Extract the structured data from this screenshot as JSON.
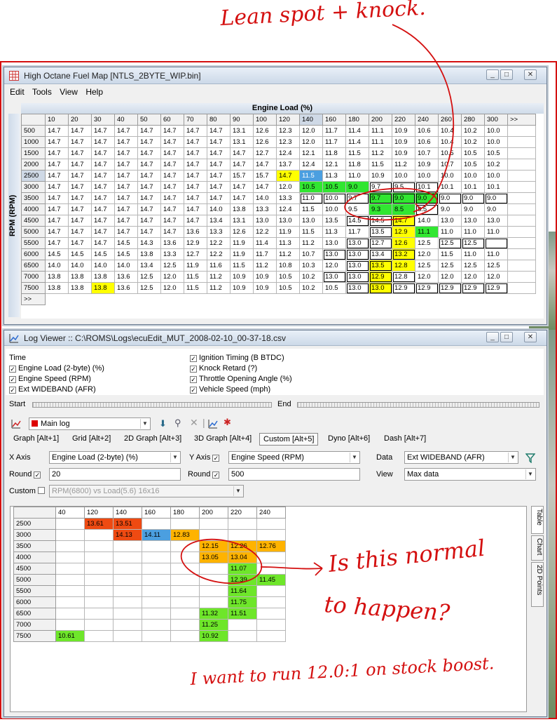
{
  "colors": {
    "cursor": "#4b9fe0",
    "yellow": "#ffff00",
    "green": "#31e631",
    "red": "#ee4a12",
    "orange": "#ffb300",
    "annotation": "#d41010"
  },
  "annotations": {
    "top": "Lean spot + knock.",
    "middle_l1": "Is this normal",
    "middle_l2": "to happen?",
    "bottom": "I want to run 12.0:1 on stock boost."
  },
  "fuel_window": {
    "title": "High Octane Fuel Map [NTLS_2BYTE_WIP.bin]",
    "menu": [
      "Edit",
      "Tools",
      "View",
      "Help"
    ],
    "x_title": "Engine Load (%)",
    "y_title": "RPM (RPM)",
    "columns": [
      "10",
      "20",
      "30",
      "40",
      "50",
      "60",
      "70",
      "80",
      "90",
      "100",
      "120",
      "140",
      "160",
      "180",
      "200",
      "220",
      "240",
      "260",
      "280",
      "300",
      ">>"
    ],
    "rows": [
      {
        "rpm": "500",
        "v": [
          "14.7",
          "14.7",
          "14.7",
          "14.7",
          "14.7",
          "14.7",
          "14.7",
          "14.7",
          "13.1",
          "12.6",
          "12.3",
          "12.0",
          "11.7",
          "11.4",
          "11.1",
          "10.9",
          "10.6",
          "10.4",
          "10.2",
          "10.0"
        ]
      },
      {
        "rpm": "1000",
        "v": [
          "14.7",
          "14.7",
          "14.7",
          "14.7",
          "14.7",
          "14.7",
          "14.7",
          "14.7",
          "13.1",
          "12.6",
          "12.3",
          "12.0",
          "11.7",
          "11.4",
          "11.1",
          "10.9",
          "10.6",
          "10.4",
          "10.2",
          "10.0"
        ]
      },
      {
        "rpm": "1500",
        "v": [
          "14.7",
          "14.7",
          "14.7",
          "14.7",
          "14.7",
          "14.7",
          "14.7",
          "14.7",
          "14.7",
          "12.7",
          "12.4",
          "12.1",
          "11.8",
          "11.5",
          "11.2",
          "10.9",
          "10.7",
          "10.5",
          "10.5",
          "10.5"
        ]
      },
      {
        "rpm": "2000",
        "v": [
          "14.7",
          "14.7",
          "14.7",
          "14.7",
          "14.7",
          "14.7",
          "14.7",
          "14.7",
          "14.7",
          "14.7",
          "13.7",
          "12.4",
          "12.1",
          "11.8",
          "11.5",
          "11.2",
          "10.9",
          "10.7",
          "10.5",
          "10.2"
        ]
      },
      {
        "rpm": "2500",
        "v": [
          "14.7",
          "14.7",
          "14.7",
          "14.7",
          "14.7",
          "14.7",
          "14.7",
          "14.7",
          "15.7",
          "15.7",
          "14.7",
          "11.5",
          "11.3",
          "11.0",
          "10.9",
          "10.0",
          "10.0",
          "10.0",
          "10.0",
          "10.0"
        ]
      },
      {
        "rpm": "3000",
        "v": [
          "14.7",
          "14.7",
          "14.7",
          "14.7",
          "14.7",
          "14.7",
          "14.7",
          "14.7",
          "14.7",
          "14.7",
          "12.0",
          "10.5",
          "10.5",
          "9.0",
          "9.7",
          "9.5",
          "10.1",
          "10.1",
          "10.1",
          "10.1"
        ]
      },
      {
        "rpm": "3500",
        "v": [
          "14.7",
          "14.7",
          "14.7",
          "14.7",
          "14.7",
          "14.7",
          "14.7",
          "14.7",
          "14.7",
          "14.0",
          "13.3",
          "11.0",
          "10.0",
          "9.7",
          "9.7",
          "9.0",
          "9.0",
          "9.0",
          "9.0",
          "9.0"
        ]
      },
      {
        "rpm": "4000",
        "v": [
          "14.7",
          "14.7",
          "14.7",
          "14.7",
          "14.7",
          "14.7",
          "14.7",
          "14.0",
          "13.8",
          "13.3",
          "12.4",
          "11.5",
          "10.0",
          "9.5",
          "9.3",
          "8.5",
          "8.5",
          "9.0",
          "9.0",
          "9.0"
        ]
      },
      {
        "rpm": "4500",
        "v": [
          "14.7",
          "14.7",
          "14.7",
          "14.7",
          "14.7",
          "14.7",
          "14.7",
          "13.4",
          "13.1",
          "13.0",
          "13.0",
          "13.0",
          "13.5",
          "14.5",
          "14.5",
          "14.7",
          "14.0",
          "13.0",
          "13.0",
          "13.0"
        ]
      },
      {
        "rpm": "5000",
        "v": [
          "14.7",
          "14.7",
          "14.7",
          "14.7",
          "14.7",
          "14.7",
          "13.6",
          "13.3",
          "12.6",
          "12.2",
          "11.9",
          "11.5",
          "11.3",
          "11.7",
          "13.5",
          "12.9",
          "11.1",
          "11.0",
          "11.0",
          "11.0"
        ]
      },
      {
        "rpm": "5500",
        "v": [
          "14.7",
          "14.7",
          "14.7",
          "14.5",
          "14.3",
          "13.6",
          "12.9",
          "12.2",
          "11.9",
          "11.4",
          "11.3",
          "11.2",
          "13.0",
          "13.0",
          "12.7",
          "12.6",
          "12.5",
          "12.5",
          "12.5"
        ]
      },
      {
        "rpm": "6000",
        "v": [
          "14.5",
          "14.5",
          "14.5",
          "14.5",
          "13.8",
          "13.3",
          "12.7",
          "12.2",
          "11.9",
          "11.7",
          "11.2",
          "10.7",
          "13.0",
          "13.0",
          "13.4",
          "13.2",
          "12.0",
          "11.5",
          "11.0",
          "11.0"
        ]
      },
      {
        "rpm": "6500",
        "v": [
          "14.0",
          "14.0",
          "14.0",
          "14.0",
          "13.4",
          "12.5",
          "11.9",
          "11.6",
          "11.5",
          "11.2",
          "10.8",
          "10.3",
          "12.0",
          "13.0",
          "13.5",
          "12.8",
          "12.5",
          "12.5",
          "12.5",
          "12.5"
        ]
      },
      {
        "rpm": "7000",
        "v": [
          "13.8",
          "13.8",
          "13.8",
          "13.6",
          "12.5",
          "12.0",
          "11.5",
          "11.2",
          "10.9",
          "10.9",
          "10.5",
          "10.2",
          "13.0",
          "13.0",
          "12.9",
          "12.8",
          "12.0",
          "12.0",
          "12.0",
          "12.0"
        ]
      },
      {
        "rpm": "7500",
        "v": [
          "13.8",
          "13.8",
          "13.8",
          "13.6",
          "12.5",
          "12.0",
          "11.5",
          "11.2",
          "10.9",
          "10.9",
          "10.5",
          "10.2",
          "10.5",
          "13.0",
          "13.0",
          "12.9",
          "12.9",
          "12.9",
          "12.9",
          "12.9"
        ]
      }
    ],
    "last_row": ">>"
  },
  "log_window": {
    "title": "Log Viewer :: C:\\ROMS\\Logs\\ecuEdit_MUT_2008-02-10_00-37-18.csv",
    "params_left": [
      "Time",
      "Engine Load (2-byte) (%)",
      "Engine Speed (RPM)",
      "Ext WIDEBAND (AFR)"
    ],
    "params_right": [
      "Ignition Timing (B BTDC)",
      "Knock Retard (?)",
      "Throttle Opening Angle (%)",
      "Vehicle Speed (mph)"
    ],
    "start_label": "Start",
    "end_label": "End",
    "log_select": "Main log",
    "tabs": [
      "Graph [Alt+1]",
      "Grid [Alt+2]",
      "2D Graph [Alt+3]",
      "3D Graph [Alt+4]",
      "Custom [Alt+5]",
      "Dyno [Alt+6]",
      "Dash [Alt+7]"
    ],
    "x_axis_label": "X Axis",
    "x_axis_value": "Engine Load (2-byte) (%)",
    "y_axis_label": "Y Axis",
    "y_axis_value": "Engine Speed (RPM)",
    "data_label": "Data",
    "data_value": "Ext WIDEBAND (AFR)",
    "round_label": "Round",
    "round_x": "20",
    "round_y": "500",
    "view_label": "View",
    "view_value": "Max data",
    "custom_label": "Custom",
    "custom_value": "RPM(6800) vs Load(5.6) 16x16",
    "side_tabs": [
      "Table",
      "Chart",
      "2D Points"
    ],
    "grid_cols": [
      "40",
      "120",
      "140",
      "160",
      "180",
      "200",
      "220",
      "240"
    ],
    "grid_rows": [
      "2500",
      "3000",
      "3500",
      "4000",
      "4500",
      "5000",
      "5500",
      "6000",
      "6500",
      "7000",
      "7500"
    ],
    "grid_cells": [
      [
        "",
        "13.61",
        "13.51",
        "",
        "",
        "",
        "",
        ""
      ],
      [
        "",
        "",
        "14.13",
        "14.11",
        "12.83",
        "",
        "",
        ""
      ],
      [
        "",
        "",
        "",
        "",
        "",
        "12.15",
        "12.26",
        "12.76"
      ],
      [
        "",
        "",
        "",
        "",
        "",
        "13.05",
        "13.04",
        ""
      ],
      [
        "",
        "",
        "",
        "",
        "",
        "",
        "11.07",
        ""
      ],
      [
        "",
        "",
        "",
        "",
        "",
        "",
        "12.39",
        "11.45"
      ],
      [
        "",
        "",
        "",
        "",
        "",
        "",
        "11.64",
        ""
      ],
      [
        "",
        "",
        "",
        "",
        "",
        "",
        "11.75",
        ""
      ],
      [
        "",
        "",
        "",
        "",
        "",
        "11.32",
        "11.51",
        ""
      ],
      [
        "",
        "",
        "",
        "",
        "",
        "11.25",
        "",
        ""
      ],
      [
        "10.61",
        "",
        "",
        "",
        "",
        "10.92",
        "",
        ""
      ]
    ]
  }
}
